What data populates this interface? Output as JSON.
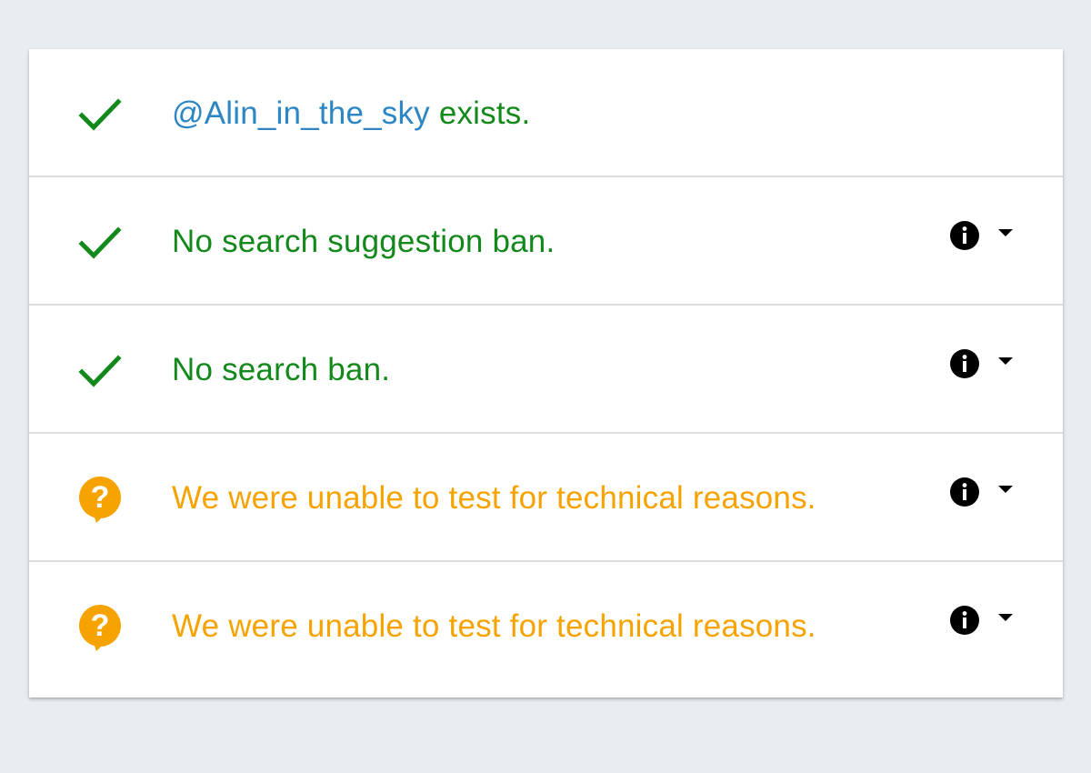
{
  "colors": {
    "ok": "#13891c",
    "handle": "#2c86c4",
    "unknown": "#f6a300",
    "icon": "#000000"
  },
  "rows": [
    {
      "status": "ok",
      "status_icon": "check-icon",
      "handle": "@Alin_in_the_sky",
      "text": " exists.",
      "has_details": false
    },
    {
      "status": "ok",
      "status_icon": "check-icon",
      "text": "No search suggestion ban.",
      "has_details": true,
      "info_icon": "info-icon",
      "expand_icon": "chevron-down-icon"
    },
    {
      "status": "ok",
      "status_icon": "check-icon",
      "text": "No search ban.",
      "has_details": true,
      "info_icon": "info-icon",
      "expand_icon": "chevron-down-icon"
    },
    {
      "status": "unknown",
      "status_icon": "question-bubble-icon",
      "text": "We were unable to test for technical reasons.",
      "has_details": true,
      "info_icon": "info-icon",
      "expand_icon": "chevron-down-icon"
    },
    {
      "status": "unknown",
      "status_icon": "question-bubble-icon",
      "text": "We were unable to test for technical reasons.",
      "has_details": true,
      "info_icon": "info-icon",
      "expand_icon": "chevron-down-icon"
    }
  ]
}
